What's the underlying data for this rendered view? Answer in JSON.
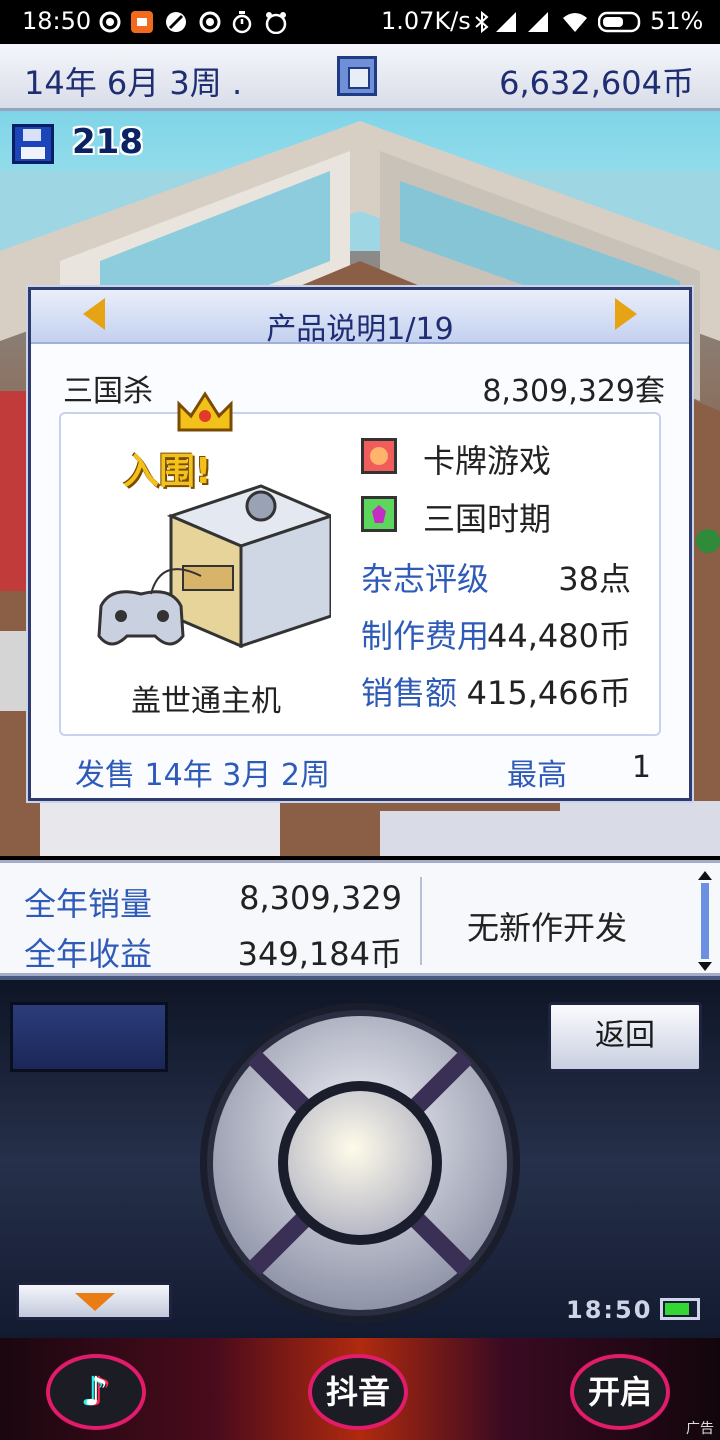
{
  "status_bar": {
    "time": "18:50",
    "net_speed": "1.07K/s",
    "battery": "51%"
  },
  "header": {
    "date": "14年 6月 3周 .",
    "money": "6,632,604币"
  },
  "hud": {
    "save_count": "218"
  },
  "dialog": {
    "title": "产品说明1/19",
    "product_name": "三国杀",
    "product_sales": "8,309,329套",
    "award": "入围!",
    "platform": "盖世通主机",
    "genre": "卡牌游戏",
    "theme": "三国时期",
    "stats": {
      "rating_label": "杂志评级",
      "rating_value": "38点",
      "cost_label": "制作费用",
      "cost_value": "44,480币",
      "revenue_label": "销售额",
      "revenue_value": "415,466币"
    },
    "release": "发售 14年 3月 2周",
    "peak_label": "最高",
    "peak_value": "1"
  },
  "summary": {
    "year_sales_label": "全年销量",
    "year_sales_value": "8,309,329",
    "year_revenue_label": "全年收益",
    "year_revenue_value": "349,184币",
    "dev_status": "无新作开发"
  },
  "controller": {
    "back_label": "返回",
    "clock": "18:50"
  },
  "ad": {
    "tiktok_glyph": "♪",
    "douyin_label": "抖音",
    "open_label": "开启",
    "ad_label": "广告"
  },
  "colors": {
    "label_blue": "#2f5bb8",
    "title_navy": "#1f2d72",
    "arrow_gold": "#e7a316",
    "award_gold": "#f2c21b"
  }
}
